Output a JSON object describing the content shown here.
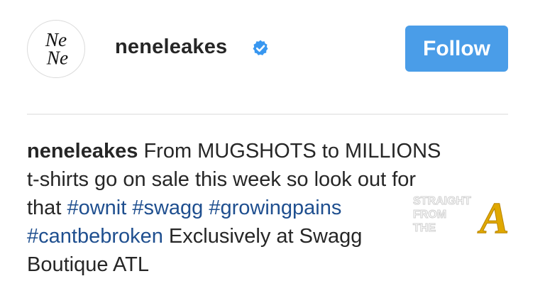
{
  "post": {
    "avatar_text_top": "Ne",
    "avatar_text_bottom": "Ne",
    "username": "neneleakes",
    "verified_icon": "verified-badge-icon",
    "follow_label": "Follow",
    "accent_color": "#4a9de8",
    "hashtag_color": "#1f4f8f"
  },
  "caption": {
    "username": "neneleakes",
    "line1_text": " From MUGSHOTS to MILLIONS",
    "line2_text": "t-shirts go on sale this week so look out for",
    "line3_text": "that ",
    "hashtags": [
      "#ownit",
      "#swagg",
      "#growingpains",
      "#cantbebroken"
    ],
    "line4_text": " Exclusively at Swagg",
    "line5_text": "Boutique ATL"
  },
  "watermark": {
    "line1": "STRAIGHT",
    "line2": "FROM",
    "line3": "THE",
    "letter": "A"
  }
}
